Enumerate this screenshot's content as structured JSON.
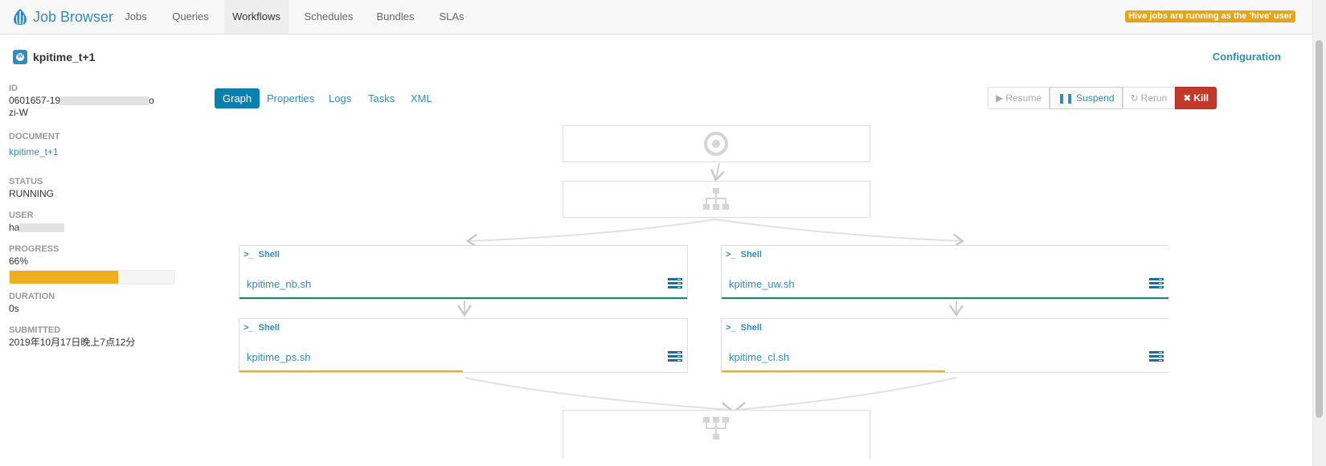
{
  "app": {
    "title": "Job Browser"
  },
  "nav": {
    "items": [
      {
        "label": "Jobs"
      },
      {
        "label": "Queries"
      },
      {
        "label": "Workflows"
      },
      {
        "label": "Schedules"
      },
      {
        "label": "Bundles"
      },
      {
        "label": "SLAs"
      }
    ],
    "active": "Workflows",
    "hive_notice": "Hive jobs are running as the 'hive' user"
  },
  "workflow": {
    "title": "kpitime_t+1",
    "configuration_label": "Configuration"
  },
  "sidebar": {
    "id_label": "ID",
    "id_value_start": "0601657-19",
    "id_value_end": "o",
    "id_value_line2": "zi-W",
    "document_label": "DOCUMENT",
    "document_value": "kpitime_t+1",
    "status_label": "STATUS",
    "status_value": "RUNNING",
    "user_label": "USER",
    "user_value": "ha",
    "progress_label": "PROGRESS",
    "progress_value": "66%",
    "progress_fraction": 0.66,
    "duration_label": "DURATION",
    "duration_value": "0s",
    "submitted_label": "SUBMITTED",
    "submitted_value": "2019年10月17日晚上7点12分"
  },
  "tabs": [
    {
      "label": "Graph"
    },
    {
      "label": "Properties"
    },
    {
      "label": "Logs"
    },
    {
      "label": "Tasks"
    },
    {
      "label": "XML"
    }
  ],
  "actions": {
    "resume": "Resume",
    "suspend": "Suspend",
    "rerun": "Rerun",
    "kill": "Kill"
  },
  "graph": {
    "actions": [
      {
        "type": "Shell",
        "name": "kpitime_nb.sh",
        "status": "done"
      },
      {
        "type": "Shell",
        "name": "kpitime_uw.sh",
        "status": "done"
      },
      {
        "type": "Shell",
        "name": "kpitime_ps.sh",
        "status": "running"
      },
      {
        "type": "Shell",
        "name": "kpitime_cl.sh",
        "status": "running"
      }
    ]
  },
  "colors": {
    "accent": "#338bb8",
    "done": "#1a8a6e",
    "running": "#f0ad1e",
    "kill": "#c0392b"
  }
}
